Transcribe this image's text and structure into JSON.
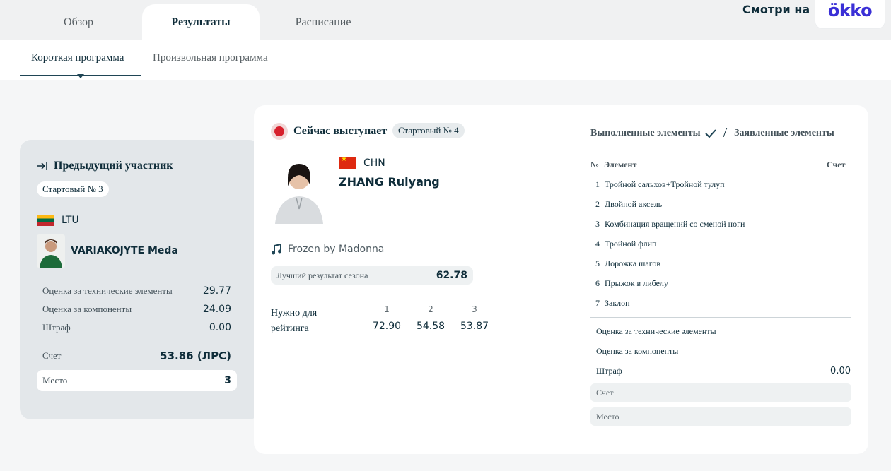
{
  "tabs": [
    {
      "label": "Обзор"
    },
    {
      "label": "Результаты"
    },
    {
      "label": "Расписание"
    }
  ],
  "watch_label": "Смотри на",
  "okko_logo": "ökko",
  "subtabs": [
    {
      "label": "Короткая программа"
    },
    {
      "label": "Произвольная программа"
    }
  ],
  "previous": {
    "title": "Предыдущий участник",
    "start_number": "Стартовый № 3",
    "country": "LTU",
    "name": "VARIAKOJYTE Meda",
    "rows": [
      {
        "label": "Оценка за технические элементы",
        "value": "29.77"
      },
      {
        "label": "Оценка за компоненты",
        "value": "24.09"
      },
      {
        "label": "Штраф",
        "value": "0.00"
      }
    ],
    "score_label": "Счет",
    "score_value": "53.86 (ЛРС)",
    "place_label": "Место",
    "place_value": "3"
  },
  "current": {
    "live_label": "Сейчас выступает",
    "start_number": "Стартовый № 4",
    "country": "CHN",
    "name": "ZHANG Ruiyang",
    "music": "Frozen by Madonna",
    "best_label": "Лучший результат сезона",
    "best_value": "62.78",
    "need_label_1": "Нужно для",
    "need_label_2": "рейтинга",
    "need_cols": [
      {
        "place": "1",
        "value": "72.90"
      },
      {
        "place": "2",
        "value": "54.58"
      },
      {
        "place": "3",
        "value": "53.87"
      }
    ]
  },
  "elements": {
    "done_label": "Выполненные элементы",
    "planned_label": "Заявленные элементы",
    "col_no": "№",
    "col_element": "Элемент",
    "col_score": "Счет",
    "items": [
      {
        "n": "1",
        "name": "Тройной сальхов+Тройной тулуп"
      },
      {
        "n": "2",
        "name": "Двойной аксель"
      },
      {
        "n": "3",
        "name": "Комбинация вращений со сменой ноги"
      },
      {
        "n": "4",
        "name": "Тройной флип"
      },
      {
        "n": "5",
        "name": "Дорожка шагов"
      },
      {
        "n": "6",
        "name": "Прыжок в либелу"
      },
      {
        "n": "7",
        "name": "Заклон"
      }
    ],
    "tech_label": "Оценка за технические элементы",
    "comp_label": "Оценка за компоненты",
    "penalty_label": "Штраф",
    "penalty_value": "0.00",
    "score_label": "Счет",
    "place_label": "Место"
  },
  "colors": {
    "accent": "#0f2d3a",
    "live": "#d7202c",
    "okko": "#3a2fd6"
  }
}
